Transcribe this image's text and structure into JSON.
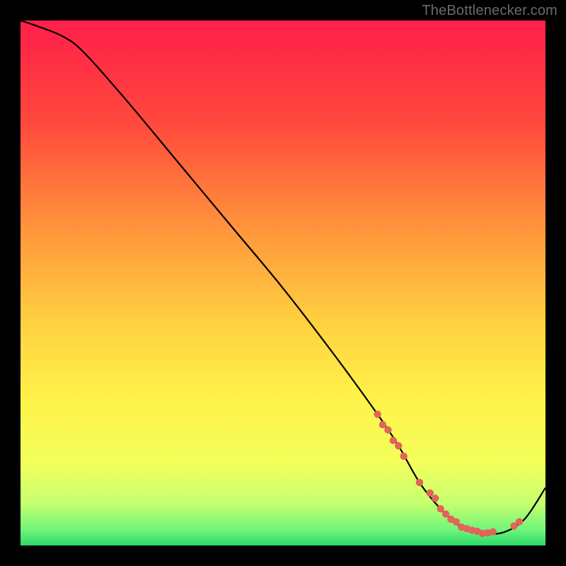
{
  "watermark": "TheBottlenecker.com",
  "chart_data": {
    "type": "line",
    "title": "",
    "xlabel": "",
    "ylabel": "",
    "xlim": [
      0,
      100
    ],
    "ylim": [
      0,
      100
    ],
    "x": [
      0,
      3,
      8,
      12,
      20,
      30,
      40,
      50,
      60,
      68,
      72,
      76,
      80,
      84,
      88,
      92,
      96,
      100
    ],
    "values": [
      100,
      99,
      97,
      94,
      85,
      73,
      61,
      49,
      36,
      25,
      19,
      12,
      7,
      3.5,
      2.3,
      2.5,
      5,
      11
    ],
    "markers": {
      "x": [
        68,
        69,
        70,
        71,
        72,
        73,
        76,
        78,
        79,
        80,
        81,
        82,
        83,
        84,
        85,
        86,
        87,
        88,
        89,
        90,
        94,
        95
      ],
      "values": [
        25,
        23,
        22,
        20,
        19,
        17,
        12,
        10,
        9,
        7,
        6,
        5,
        4.5,
        3.5,
        3.2,
        2.9,
        2.7,
        2.3,
        2.4,
        2.6,
        3.7,
        4.5
      ]
    },
    "background_gradient": {
      "stops": [
        {
          "offset": 0.0,
          "color": "#ff1f4a"
        },
        {
          "offset": 0.2,
          "color": "#ff4a3c"
        },
        {
          "offset": 0.4,
          "color": "#ff963c"
        },
        {
          "offset": 0.58,
          "color": "#ffd240"
        },
        {
          "offset": 0.72,
          "color": "#fff24a"
        },
        {
          "offset": 0.84,
          "color": "#f4ff5a"
        },
        {
          "offset": 0.92,
          "color": "#c6ff70"
        },
        {
          "offset": 0.97,
          "color": "#70f57a"
        },
        {
          "offset": 1.0,
          "color": "#2cd96a"
        }
      ]
    },
    "curve_color": "#000000",
    "marker_color": "#e2645a"
  }
}
